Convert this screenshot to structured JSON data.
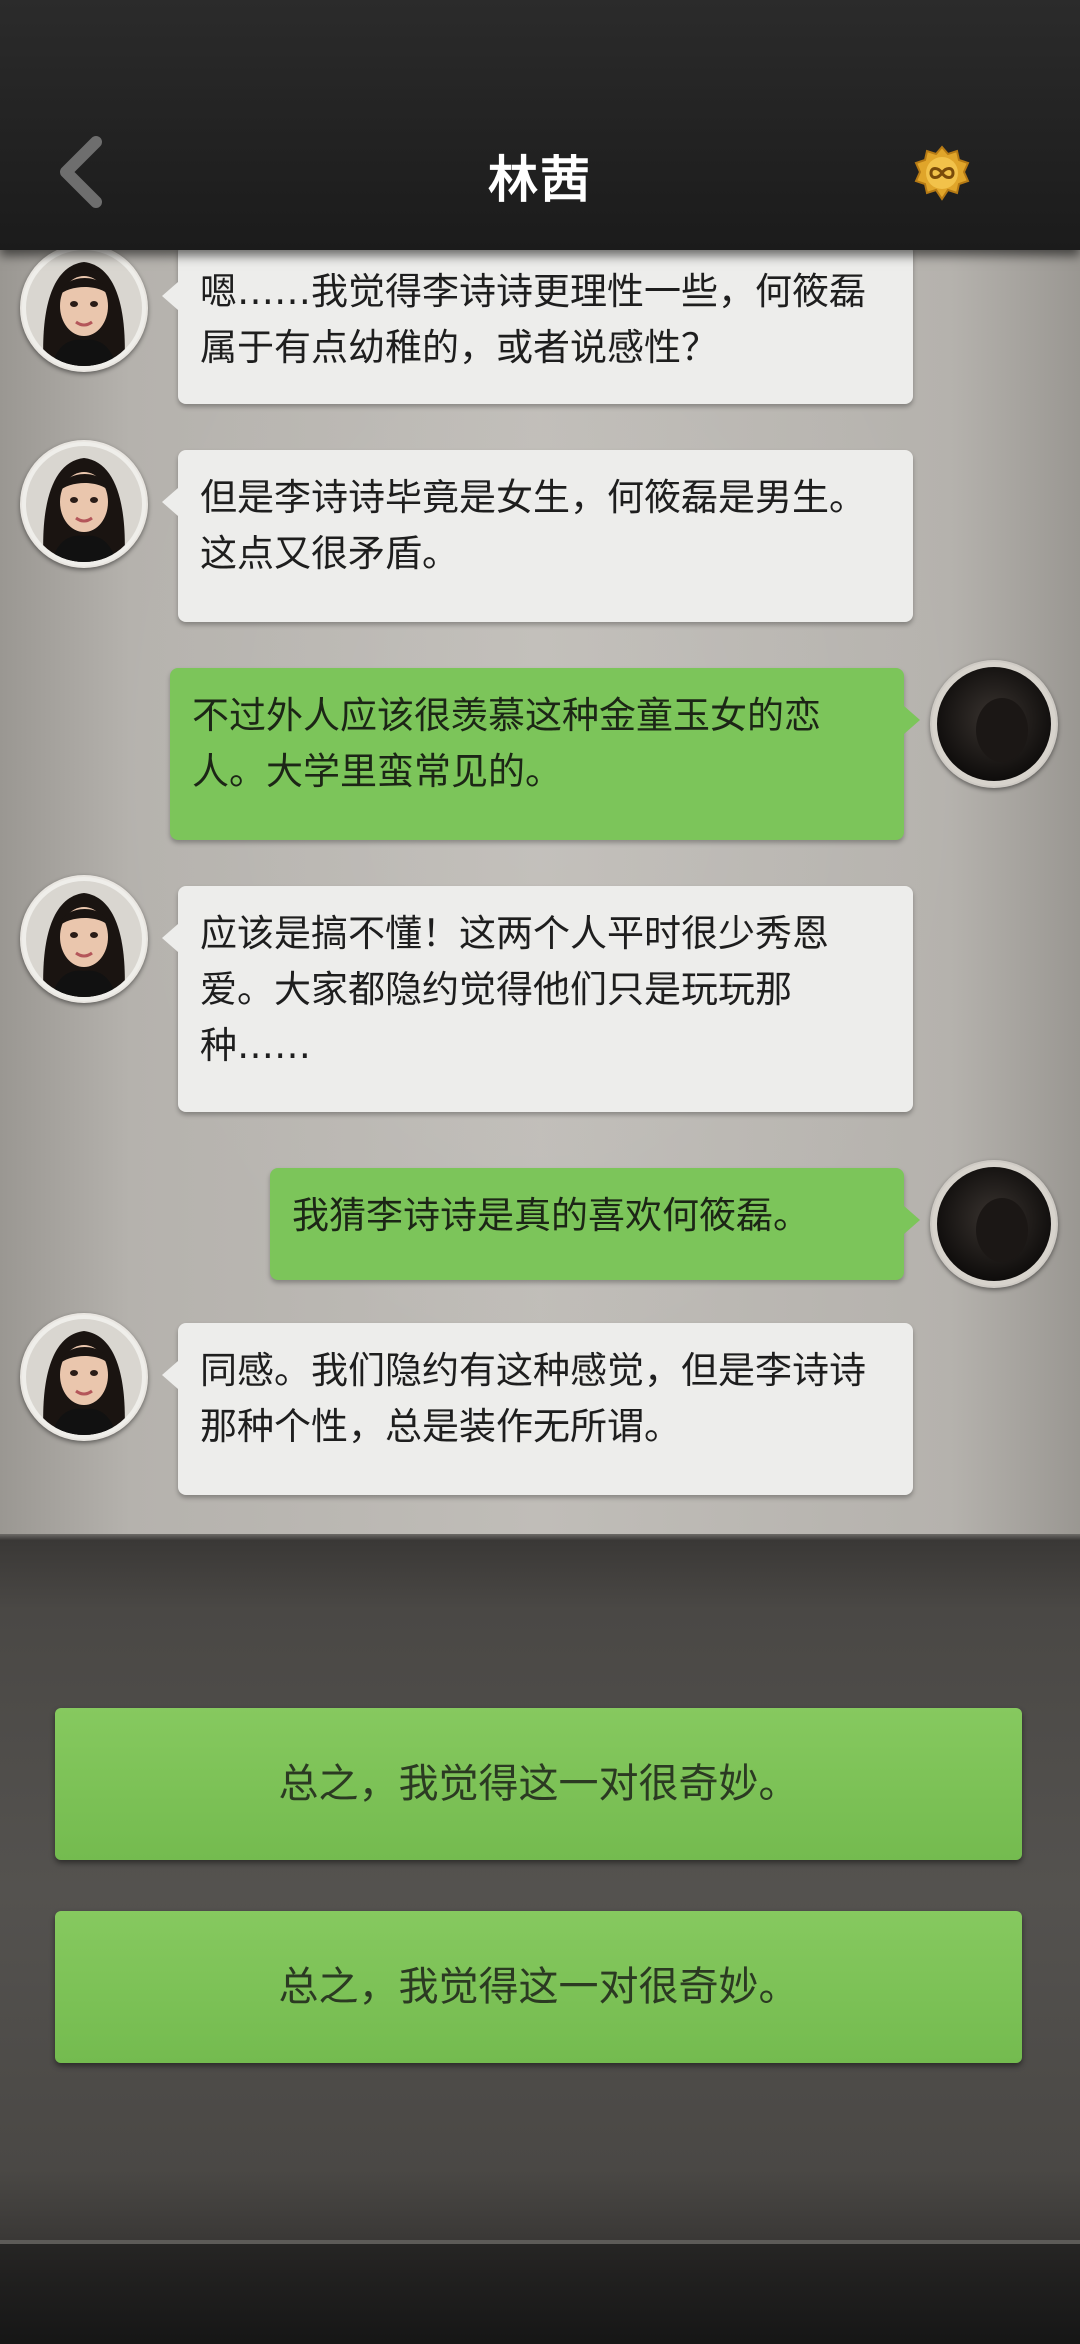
{
  "header": {
    "title": "林茜",
    "back_icon": "chevron-left-icon",
    "coin_icon": "infinity-coin-icon",
    "coin_color": "#e0a52a"
  },
  "messages": [
    {
      "side": "in",
      "text": "嗯……我觉得李诗诗更理性一些，何筱磊属于有点幼稚的，或者说感性？"
    },
    {
      "side": "in",
      "text": "但是李诗诗毕竟是女生，何筱磊是男生。这点又很矛盾。"
    },
    {
      "side": "out",
      "text": "不过外人应该很羡慕这种金童玉女的恋人。大学里蛮常见的。"
    },
    {
      "side": "in",
      "text": "应该是搞不懂！这两个人平时很少秀恩爱。大家都隐约觉得他们只是玩玩那种……"
    },
    {
      "side": "out",
      "text": "我猜李诗诗是真的喜欢何筱磊。"
    },
    {
      "side": "in",
      "text": "同感。我们隐约有这种感觉，但是李诗诗那种个性，总是装作无所谓。"
    }
  ],
  "choices": [
    {
      "label": "总之，我觉得这一对很奇妙。"
    },
    {
      "label": "总之，我觉得这一对很奇妙。"
    }
  ],
  "colors": {
    "incoming_bubble": "#ededeb",
    "outgoing_bubble": "#7cc55a",
    "choice_button": "#7cc55a"
  }
}
